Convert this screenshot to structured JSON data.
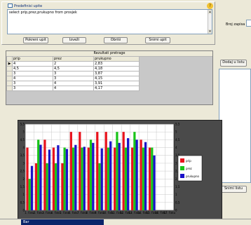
{
  "query_panel": {
    "title": "Predefinisi upite",
    "sql": "select prip,prez,prukupno  from prosjek"
  },
  "side": {
    "row_count_label": "Broj zapisa"
  },
  "buttons": {
    "run": "Pokreni upit",
    "save": "Izveži",
    "clear": "Obriši",
    "new": "Snimi upit",
    "add_field": "Dodaj u listu",
    "save_list": "Snimi listu"
  },
  "results": {
    "caption": "Rezultati pretrage",
    "columns": [
      "prip",
      "prez",
      "prukupno"
    ],
    "rows": [
      [
        "4",
        "2",
        "2,83"
      ],
      [
        "4,5",
        "4,5",
        "4,18"
      ],
      [
        "3",
        "3",
        "3,87"
      ],
      [
        "4",
        "3",
        "4,15"
      ],
      [
        "3",
        "4",
        "3,91"
      ],
      [
        "3",
        "4",
        "4,17"
      ]
    ]
  },
  "status": {
    "item": "Bar"
  },
  "chart_data": {
    "type": "bar",
    "categories": [
      "1. Faku",
      "2. Faku",
      "3. Faku",
      "4. Faku",
      "5. Faku",
      "6. Faku",
      "7. Faku",
      "8. Faku",
      "9. Faku",
      "10. Faku",
      "11. Faku",
      "12. Faku",
      "13. Faku",
      "14. Faku",
      "15. Faku",
      "16. Faku",
      "17. Faku"
    ],
    "series": [
      {
        "name": "prip",
        "color": "#e8121c",
        "values": [
          4,
          3,
          4.5,
          4,
          3,
          5,
          5,
          4,
          5,
          5,
          4,
          5,
          4,
          4.5,
          4,
          0,
          0
        ]
      },
      {
        "name": "prez",
        "color": "#19c419",
        "values": [
          2,
          4.5,
          3,
          3,
          4,
          4,
          4,
          4.5,
          3,
          4,
          5,
          4,
          5,
          4,
          4,
          0,
          0
        ]
      },
      {
        "name": "prukupno",
        "color": "#1a12c8",
        "values": [
          2.83,
          4.18,
          3.87,
          4.15,
          3.91,
          4.17,
          4.05,
          4.3,
          3.95,
          4.4,
          4.3,
          4.6,
          4.5,
          4.35,
          3.5,
          0,
          0
        ]
      }
    ],
    "ylim": [
      0,
      5.5
    ],
    "yticks": [
      "0",
      "0,5",
      "1",
      "1,5",
      "2",
      "2,5",
      "3",
      "3,5",
      "4",
      "4,5",
      "5",
      "5,5"
    ],
    "grid": true,
    "legend": "right"
  }
}
